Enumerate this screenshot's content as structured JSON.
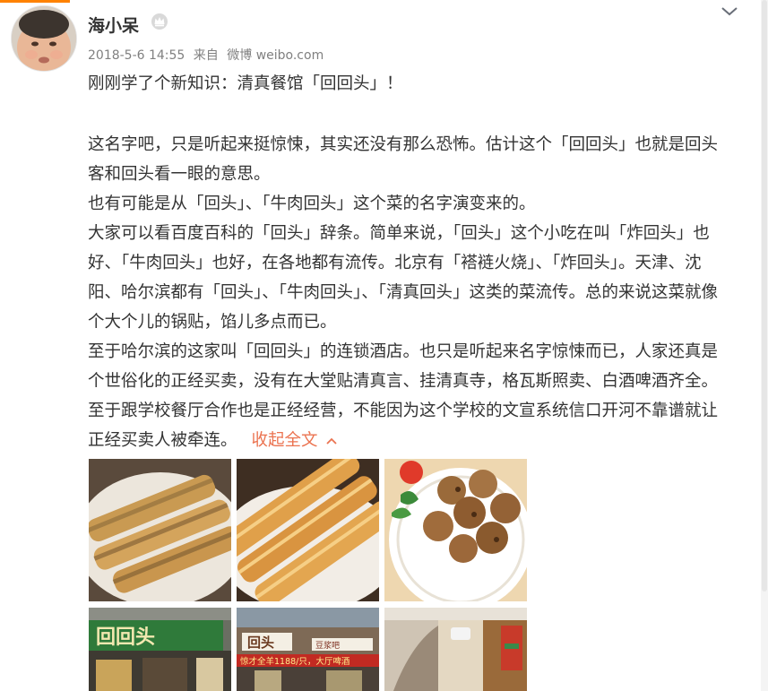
{
  "post": {
    "username": "海小呆",
    "timestamp": "2018-5-6 14:55",
    "source_prefix": "来自",
    "source": "微博 weibo.com",
    "headline": "刚刚学了个新知识：清真餐馆「回回头」！",
    "paragraphs": [
      "这名字吧，只是听起来挺惊悚，其实还没有那么恐怖。估计这个「回回头」也就是回头客和回头看一眼的意思。",
      "也有可能是从「回头」、「牛肉回头」这个菜的名字演变来的。",
      "大家可以看百度百科的「回头」辞条。简单来说，「回头」这个小吃在叫「炸回头」也好、「牛肉回头」也好，在各地都有流传。北京有「褡裢火烧」、「炸回头」。天津、沈阳、哈尔滨都有「回头」、「牛肉回头」、「清真回头」这类的菜流传。总的来说这菜就像个大个儿的锅贴，馅儿多点而已。",
      "至于哈尔滨的这家叫「回回头」的连锁酒店。也只是听起来名字惊悚而已，人家还真是个世俗化的正经买卖，没有在大堂贴清真言、挂清真寺，格瓦斯照卖、白酒啤酒齐全。至于跟学校餐厅合作也是正经经营，不能因为这个学校的文宣系统信口开河不靠谱就让正经买卖人被牵连。"
    ],
    "collapse_label": "收起全文",
    "icons": {
      "avatar": "avatar",
      "crown": "crown-icon",
      "more": "chevron-down-icon",
      "collapse": "chevron-up-icon"
    },
    "colors": {
      "link": "#eb7350",
      "accent": "#ff8200",
      "meta": "#808080"
    }
  },
  "photos": {
    "sign1_text": "回回头",
    "sign2_text": "回头",
    "sign2_sub": "豆浆吧",
    "banner_text": "惊才全羊1188/只，大厅啤酒"
  }
}
